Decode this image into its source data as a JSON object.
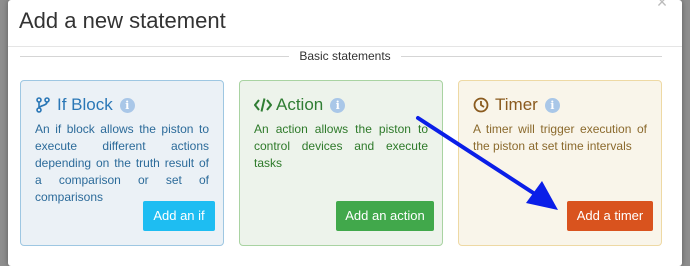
{
  "dialog": {
    "title": "Add a new statement",
    "section_label": "Basic statements"
  },
  "cards": {
    "if_block": {
      "title": "If Block",
      "description": "An if block allows the piston to execute different actions depending on the truth result of a comparison or set of comparisons",
      "button_label": "Add an if",
      "icon": "code-fork-icon",
      "color": "#1ebdf2"
    },
    "action": {
      "title": "Action",
      "description": "An action allows the piston to control devices and execute tasks",
      "button_label": "Add an action",
      "icon": "code-icon",
      "color": "#41a84b"
    },
    "timer": {
      "title": "Timer",
      "description": "A timer will trigger execution of the piston at set time intervals",
      "button_label": "Add a timer",
      "icon": "clock-icon",
      "color": "#d9531e"
    }
  },
  "annotation": {
    "arrow_color": "#0a1ee8"
  }
}
